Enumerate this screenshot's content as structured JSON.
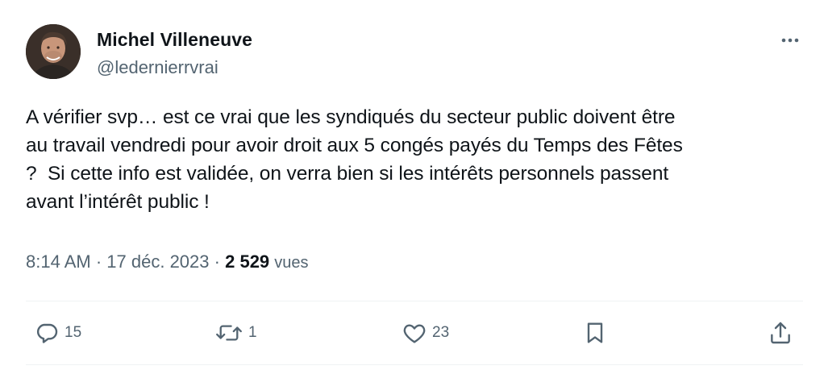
{
  "author": {
    "name": "Michel Villeneuve",
    "handle": "@ledernierrvrai"
  },
  "tweet": {
    "text": "A vérifier svp… est ce vrai que les syndiqués du secteur public doivent être\nau travail vendredi pour avoir droit aux 5 congés payés du Temps des Fêtes\n?  Si cette info est validée, on verra bien si les intérêts personnels passent\navant l’intérêt public !"
  },
  "meta": {
    "time": "8:14 AM",
    "separator": "·",
    "date": "17 déc. 2023",
    "views_count": "2 529",
    "views_label": "vues"
  },
  "actions": {
    "replies": "15",
    "retweets": "1",
    "likes": "23"
  },
  "icons": [
    "more-icon",
    "reply-icon",
    "retweet-icon",
    "like-icon",
    "bookmark-icon",
    "share-icon"
  ],
  "colors": {
    "text": "#0f1419",
    "secondary": "#536471",
    "divider": "#eff3f4"
  }
}
